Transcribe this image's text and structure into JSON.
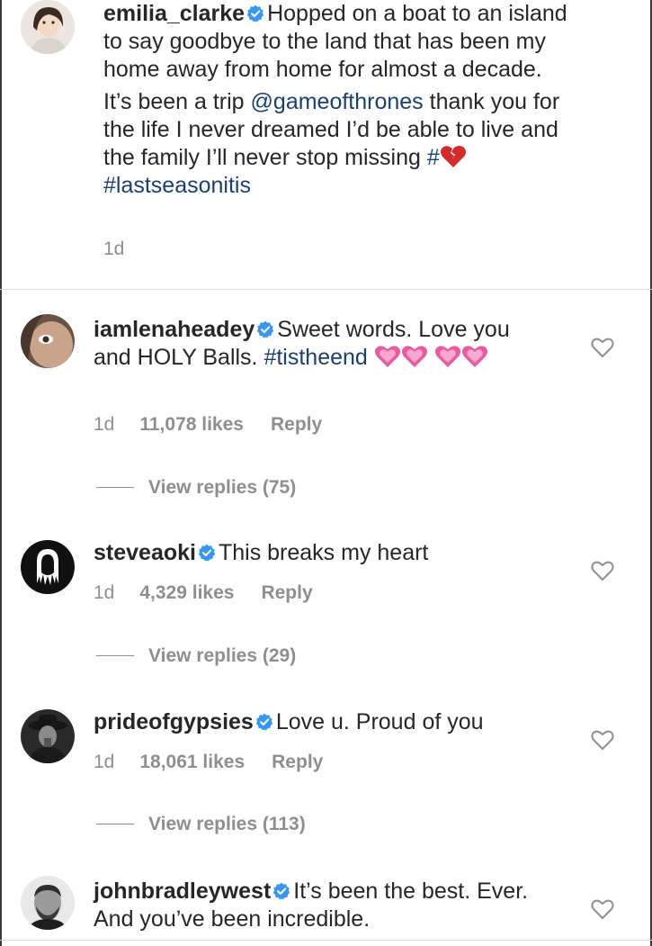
{
  "post": {
    "username": "emilia_clarke",
    "text_line1": "Hopped on a boat to an island to say goodbye to the land that has been my home away from home for almost a decade.",
    "text2_before": "It’s been a trip ",
    "mention": "@gameofthrones",
    "text2_after": " thank you for the life I never dreamed I’d be able to live and the family I’ll never stop missing ",
    "hashtag_symbol": "#",
    "hashtag": "#lastseasonitis",
    "time": "1d",
    "icon": "broken-heart-emoji"
  },
  "comments": [
    {
      "username": "iamlenaheadey",
      "text": "Sweet words. Love you and HOLY Balls. ",
      "hashtag": "#tistheend",
      "time": "1d",
      "likes": "11,078 likes",
      "reply": "Reply",
      "view_replies": "View replies (75)",
      "icon": "sparkling-heart-emoji"
    },
    {
      "username": "steveaoki",
      "text": "This breaks my heart",
      "time": "1d",
      "likes": "4,329 likes",
      "reply": "Reply",
      "view_replies": "View replies (29)"
    },
    {
      "username": "prideofgypsies",
      "text": "Love u. Proud of you",
      "time": "1d",
      "likes": "18,061 likes",
      "reply": "Reply",
      "view_replies": "View replies (113)"
    },
    {
      "username": "johnbradleywest",
      "text": "It’s been the best. Ever. And you’ve been incredible."
    }
  ],
  "colors": {
    "link": "#1b3f6e",
    "muted": "#8e8e8e",
    "verified": "#3897f0",
    "text": "#262626"
  }
}
